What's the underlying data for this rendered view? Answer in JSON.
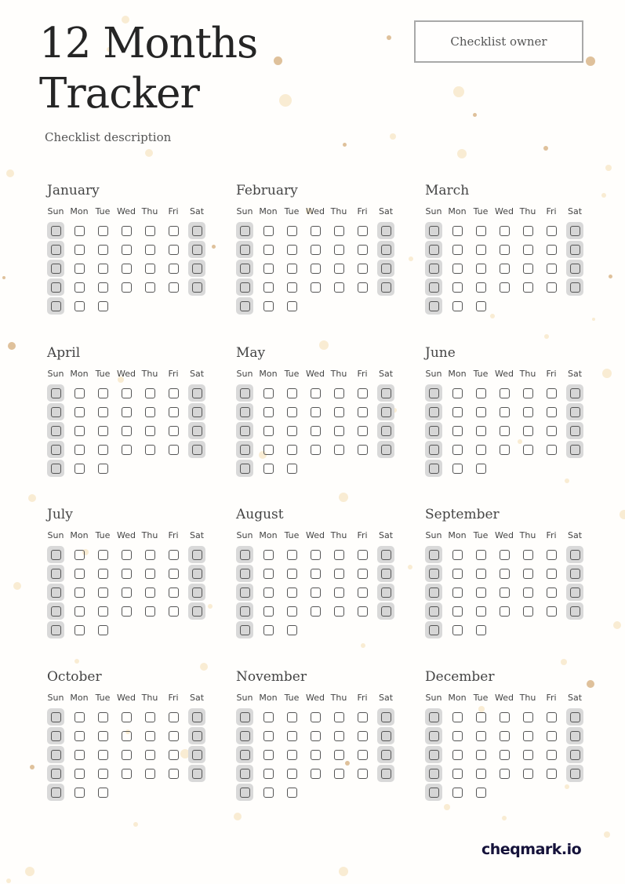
{
  "header": {
    "title_line1": "12 Months",
    "title_line2": "Tracker",
    "description": "Checklist description",
    "owner_label": "Checklist owner"
  },
  "weekdays": [
    "Sun",
    "Mon",
    "Tue",
    "Wed",
    "Thu",
    "Fri",
    "Sat"
  ],
  "days_per_month": 31,
  "months": [
    {
      "name": "January"
    },
    {
      "name": "February"
    },
    {
      "name": "March"
    },
    {
      "name": "April"
    },
    {
      "name": "May"
    },
    {
      "name": "June"
    },
    {
      "name": "July"
    },
    {
      "name": "August"
    },
    {
      "name": "September"
    },
    {
      "name": "October"
    },
    {
      "name": "November"
    },
    {
      "name": "December"
    }
  ],
  "colors": {
    "weekend_highlight": "#d9d9d9",
    "checkbox_border": "#555555",
    "dot_light": "#f8e7c8",
    "dot_dark": "#d9b68a",
    "logo": "#15123a"
  },
  "footer": {
    "brand": "cheqmark.io"
  }
}
